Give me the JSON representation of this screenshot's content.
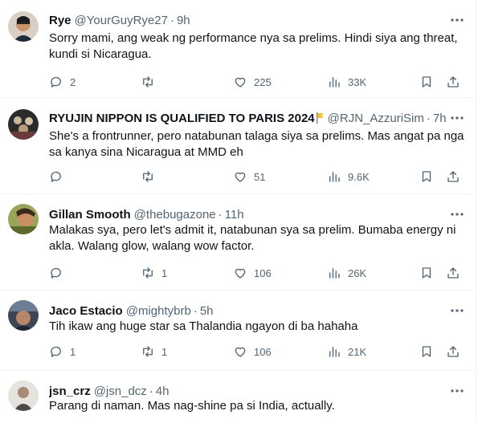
{
  "tweets": [
    {
      "name": "Rye",
      "handle": "@YourGuyRye27",
      "time": "9h",
      "text": "Sorry mami, ang weak ng performance nya sa prelims.  Hindi siya ang threat, kundi si Nicaragua.",
      "replies": "2",
      "retweets": "",
      "likes": "225",
      "views": "33K"
    },
    {
      "name": "RYUJIN NIPPON IS QUALIFIED TO PARIS 2024",
      "handle": "@RJN_AzzuriSim",
      "time": "7h",
      "text": "She's a frontrunner, pero natabunan talaga siya sa prelims. Mas angat pa nga sa kanya sina Nicaragua at MMD eh",
      "replies": "",
      "retweets": "",
      "likes": "51",
      "views": "9.6K"
    },
    {
      "name": "Gillan Smooth",
      "handle": "@thebugazone",
      "time": "11h",
      "text": "Malakas sya, pero let's admit it, natabunan sya sa prelim. Bumaba energy ni akla. Walang glow, walang wow factor.",
      "replies": "",
      "retweets": "1",
      "likes": "106",
      "views": "26K"
    },
    {
      "name": "Jaco Estacio",
      "handle": "@mightybrb",
      "time": "5h",
      "text": "Tih ikaw ang huge star sa Thalandia ngayon di ba hahaha",
      "replies": "1",
      "retweets": "1",
      "likes": "106",
      "views": "21K"
    },
    {
      "name": "jsn_crz",
      "handle": "@jsn_dcz",
      "time": "4h",
      "text": "Parang di naman. Mas nag-shine pa si India, actually.",
      "replies": "",
      "retweets": "",
      "likes": "",
      "views": ""
    }
  ],
  "colors": {
    "text": "#0f1419",
    "secondary": "#536471",
    "divider": "#eff3f4"
  },
  "icons": [
    "reply-icon",
    "retweet-icon",
    "like-icon",
    "views-icon",
    "bookmark-icon",
    "share-icon",
    "more-icon"
  ]
}
